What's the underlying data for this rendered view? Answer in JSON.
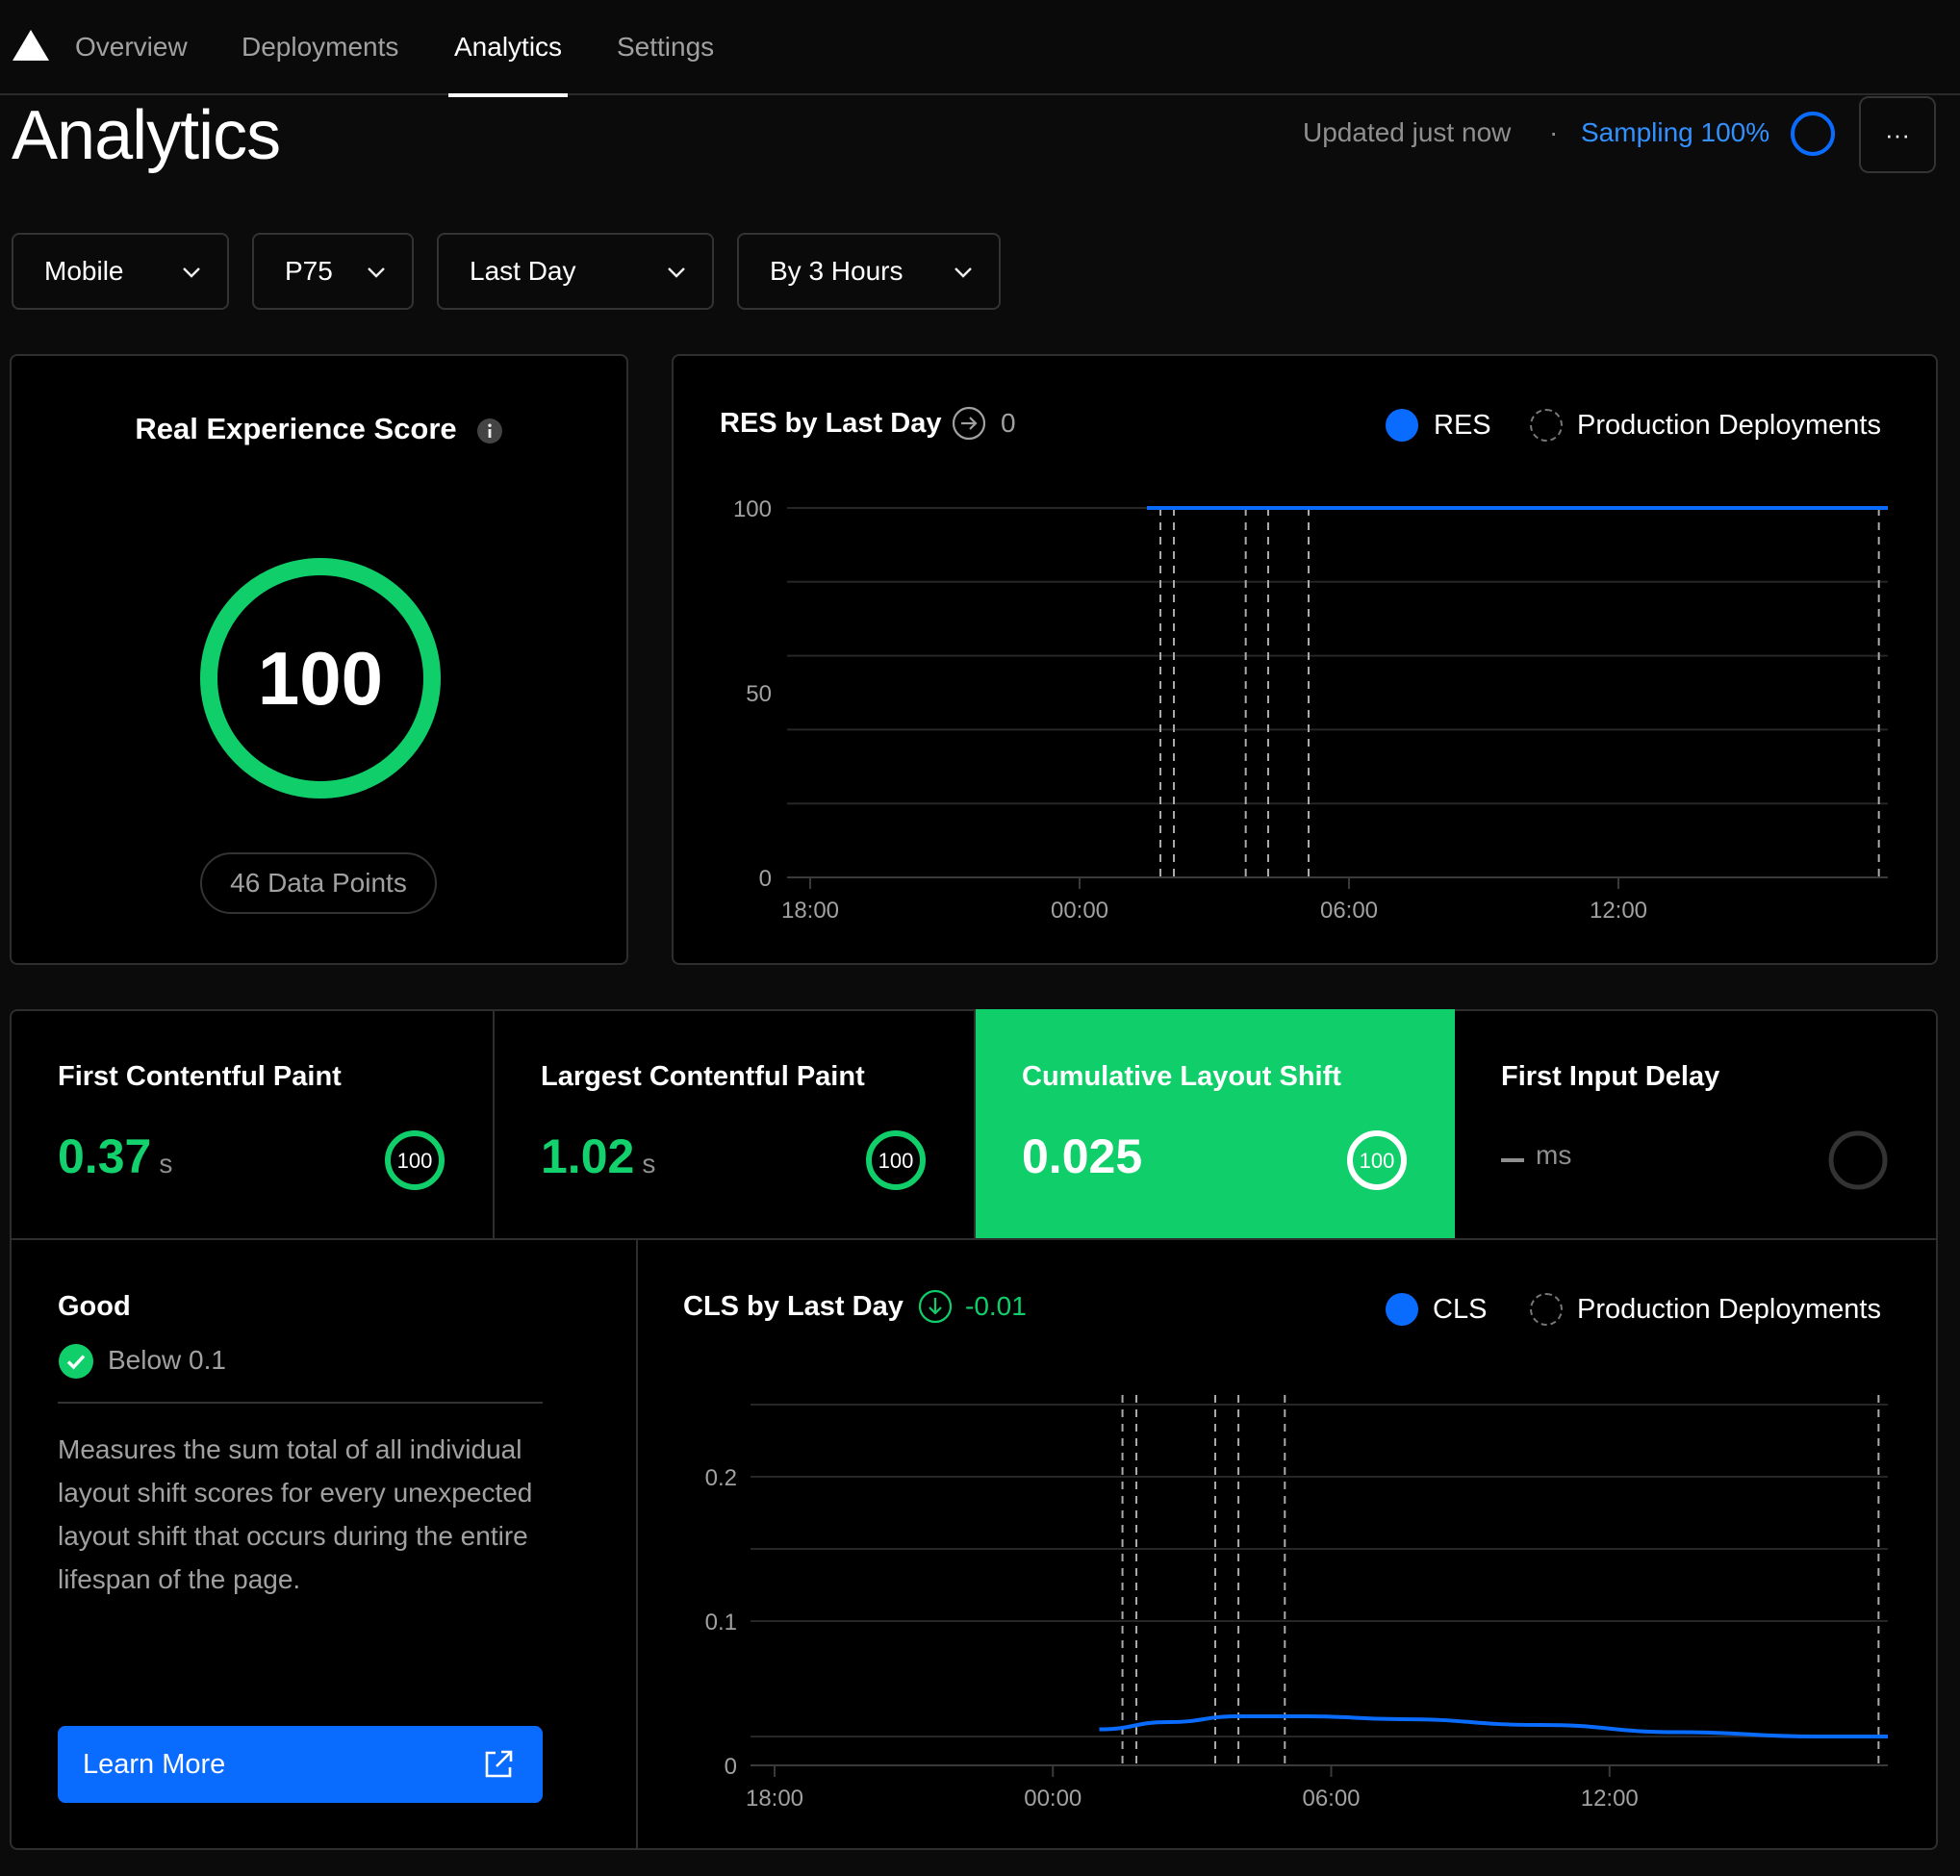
{
  "nav": {
    "logo": "vercel-triangle-icon",
    "tabs": [
      {
        "label": "Overview"
      },
      {
        "label": "Deployments"
      },
      {
        "label": "Analytics",
        "active": true
      },
      {
        "label": "Settings"
      }
    ]
  },
  "header": {
    "title": "Analytics",
    "updated": "Updated just now",
    "separator": "·",
    "sampling": "Sampling 100%",
    "more_label": "···"
  },
  "filters": {
    "device": "Mobile",
    "percentile": "P75",
    "range": "Last Day",
    "granularity": "By 3 Hours"
  },
  "score": {
    "title": "Real Experience Score",
    "value": "100",
    "data_points": "46 Data Points",
    "ring_fraction": 1.0
  },
  "res_chart": {
    "title": "RES by Last Day",
    "delta": "0",
    "legend": [
      "RES",
      "Production Deployments"
    ]
  },
  "metrics": [
    {
      "label": "First Contentful Paint",
      "value": "0.37",
      "unit": "s",
      "badge": "100"
    },
    {
      "label": "Largest Contentful Paint",
      "value": "1.02",
      "unit": "s",
      "badge": "100"
    },
    {
      "label": "Cumulative Layout Shift",
      "value": "0.025",
      "unit": "",
      "badge": "100",
      "active": true
    },
    {
      "label": "First Input Delay",
      "value": "",
      "unit": "ms",
      "badge": ""
    }
  ],
  "detail": {
    "rating": "Good",
    "threshold": "Below 0.1",
    "description": "Measures the sum total of all individual layout shift scores for every unexpected layout shift that occurs during the entire lifespan of the page.",
    "button": "Learn More"
  },
  "cls_chart": {
    "title": "CLS by Last Day",
    "delta": "-0.01",
    "legend": [
      "CLS",
      "Production Deployments"
    ]
  },
  "colors": {
    "good": "#10cf6a",
    "accent": "#0a6cff",
    "link": "#3291ff"
  },
  "chart_data": [
    {
      "type": "line",
      "title": "RES by Last Day",
      "x_ticks": [
        "18:00",
        "00:00",
        "06:00",
        "12:00"
      ],
      "y_ticks": [
        "0",
        "50",
        "100"
      ],
      "ylim": [
        0,
        100
      ],
      "xlim_hours": [
        18,
        42
      ],
      "series": [
        {
          "name": "RES",
          "x_hours": [
            25.5,
            28.5,
            31.5,
            34.5,
            37.5,
            40.5,
            42
          ],
          "values": [
            100,
            100,
            100,
            100,
            100,
            100,
            100
          ]
        }
      ],
      "deployments_hours": [
        25.8,
        26.1,
        27.7,
        28.2,
        29.1,
        41.8
      ],
      "grid": true,
      "legend": "top-right"
    },
    {
      "type": "line",
      "title": "CLS by Last Day",
      "x_ticks": [
        "18:00",
        "00:00",
        "06:00",
        "12:00"
      ],
      "y_ticks": [
        "0",
        "0.1",
        "0.2"
      ],
      "ylim": [
        0,
        0.26
      ],
      "xlim_hours": [
        18,
        42
      ],
      "series": [
        {
          "name": "CLS",
          "x_hours": [
            25.0,
            26.5,
            28.0,
            29.5,
            31.5,
            34.5,
            37.5,
            40.5,
            42
          ],
          "values": [
            0.025,
            0.03,
            0.034,
            0.034,
            0.032,
            0.028,
            0.023,
            0.02,
            0.02
          ]
        }
      ],
      "deployments_hours": [
        25.5,
        25.8,
        27.5,
        28.0,
        29.0,
        41.8
      ],
      "grid": true,
      "legend": "top-right"
    }
  ]
}
